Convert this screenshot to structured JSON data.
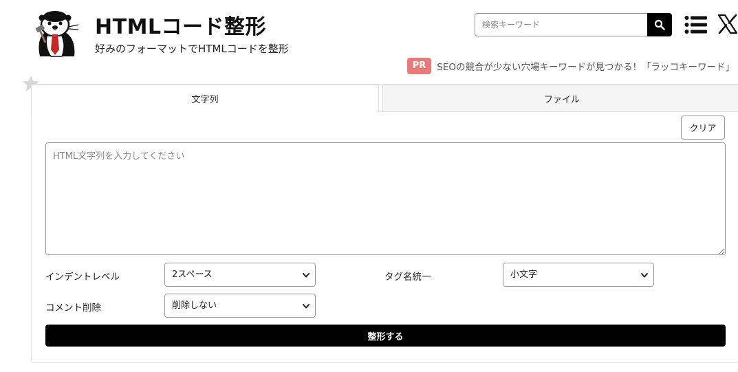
{
  "header": {
    "title": "HTMLコード整形",
    "subtitle": "好みのフォーマットでHTMLコードを整形",
    "logo_icon": "otter-mascot-logo",
    "search": {
      "placeholder": "検索キーワード",
      "icon": "search-icon"
    },
    "menu_icon": "list-menu-icon",
    "social_icon": "x-icon"
  },
  "promo": {
    "badge": "PR",
    "text": "SEOの競合が少ない穴場キーワードが見つかる！「ラッコキーワード」",
    "badge_color": "#e87a7a"
  },
  "favorite_icon": "star-icon",
  "tabs": [
    {
      "label": "文字列",
      "active": true
    },
    {
      "label": "ファイル",
      "active": false
    }
  ],
  "editor": {
    "clear_label": "クリア",
    "placeholder": "HTML文字列を入力してください",
    "value": ""
  },
  "options": {
    "indent": {
      "label": "インデントレベル",
      "selected": "2スペース"
    },
    "tag_case": {
      "label": "タグ名統一",
      "selected": "小文字"
    },
    "comment": {
      "label": "コメント削除",
      "selected": "削除しない"
    }
  },
  "submit_label": "整形する"
}
